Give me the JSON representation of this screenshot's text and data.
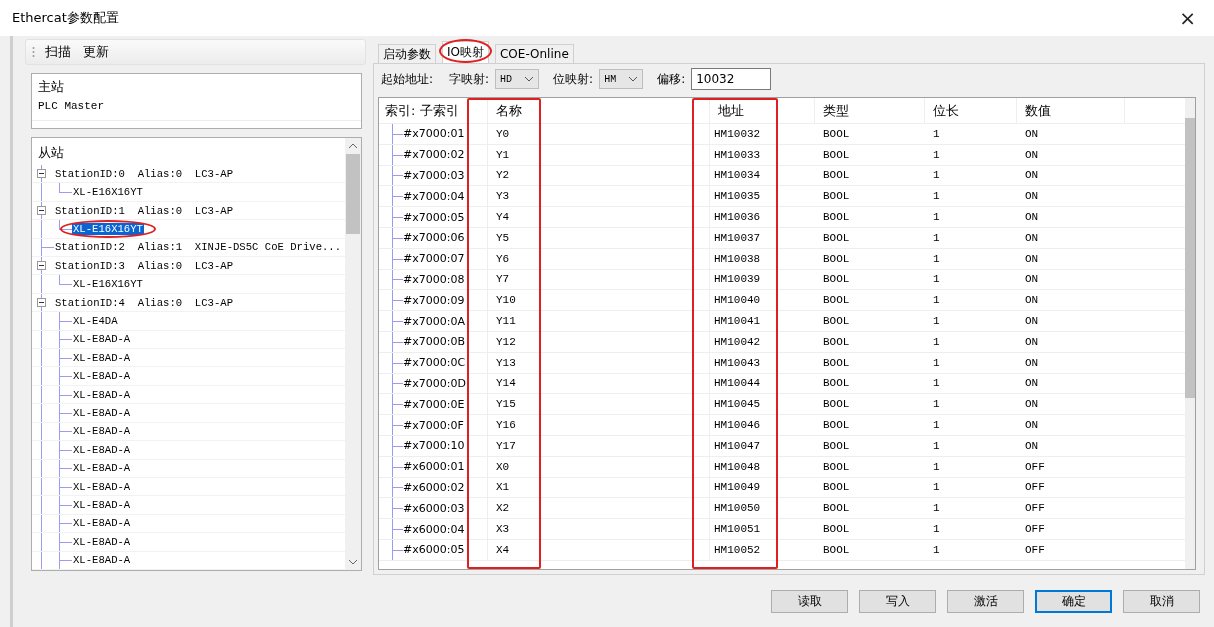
{
  "window": {
    "title": "Ethercat参数配置",
    "close": "×"
  },
  "left_toolbar": {
    "buttons": [
      "扫描",
      "更新"
    ]
  },
  "master": {
    "title": "主站",
    "items": [
      "PLC Master"
    ]
  },
  "slaves": {
    "title": "从站",
    "tree": [
      {
        "label": "StationID:0  Alias:0  LC3-AP",
        "expanded": true,
        "selected": false,
        "children": [
          {
            "label": "XL-E16X16YT",
            "selected": false,
            "circled": false
          }
        ]
      },
      {
        "label": "StationID:1  Alias:0  LC3-AP",
        "expanded": true,
        "selected": false,
        "children": [
          {
            "label": "XL-E16X16YT",
            "selected": true,
            "circled": true
          }
        ]
      },
      {
        "label": "StationID:2  Alias:1  XINJE-DS5C CoE Drive...",
        "selected": false
      },
      {
        "label": "StationID:3  Alias:0  LC3-AP",
        "expanded": true,
        "selected": false,
        "children": [
          {
            "label": "XL-E16X16YT",
            "selected": false,
            "circled": false
          }
        ]
      },
      {
        "label": "StationID:4  Alias:0  LC3-AP",
        "expanded": true,
        "selected": false,
        "children": [
          {
            "label": "XL-E4DA",
            "selected": false,
            "circled": false
          },
          {
            "label": "XL-E8AD-A",
            "selected": false,
            "circled": false
          },
          {
            "label": "XL-E8AD-A",
            "selected": false,
            "circled": false
          },
          {
            "label": "XL-E8AD-A",
            "selected": false,
            "circled": false
          },
          {
            "label": "XL-E8AD-A",
            "selected": false,
            "circled": false
          },
          {
            "label": "XL-E8AD-A",
            "selected": false,
            "circled": false
          },
          {
            "label": "XL-E8AD-A",
            "selected": false,
            "circled": false
          },
          {
            "label": "XL-E8AD-A",
            "selected": false,
            "circled": false
          },
          {
            "label": "XL-E8AD-A",
            "selected": false,
            "circled": false
          },
          {
            "label": "XL-E8AD-A",
            "selected": false,
            "circled": false
          },
          {
            "label": "XL-E8AD-A",
            "selected": false,
            "circled": false
          },
          {
            "label": "XL-E8AD-A",
            "selected": false,
            "circled": false
          },
          {
            "label": "XL-E8AD-A",
            "selected": false,
            "circled": false
          },
          {
            "label": "XL-E8AD-A",
            "selected": false,
            "circled": false
          }
        ]
      }
    ]
  },
  "tabs": [
    {
      "label": "启动参数",
      "selected": false,
      "circled": false
    },
    {
      "label": "IO映射",
      "selected": true,
      "circled": true
    },
    {
      "label": "COE-Online",
      "selected": false,
      "circled": false
    }
  ],
  "mapping": {
    "start_label": "起始地址:",
    "word_label": "字映射:",
    "word_value": "HD",
    "bit_label": "位映射:",
    "bit_value": "HM",
    "offset_label": "偏移:",
    "offset_value": "10032"
  },
  "table": {
    "columns": [
      {
        "label": "索引: 子索引",
        "highlighted": false
      },
      {
        "label": "名称",
        "highlighted": true
      },
      {
        "label": "地址",
        "highlighted": true
      },
      {
        "label": "类型",
        "highlighted": false
      },
      {
        "label": "位长",
        "highlighted": false
      },
      {
        "label": "数值",
        "highlighted": false
      }
    ],
    "rows": [
      [
        "#x7000:01",
        "Y0",
        "HM10032",
        "BOOL",
        "1",
        "ON"
      ],
      [
        "#x7000:02",
        "Y1",
        "HM10033",
        "BOOL",
        "1",
        "ON"
      ],
      [
        "#x7000:03",
        "Y2",
        "HM10034",
        "BOOL",
        "1",
        "ON"
      ],
      [
        "#x7000:04",
        "Y3",
        "HM10035",
        "BOOL",
        "1",
        "ON"
      ],
      [
        "#x7000:05",
        "Y4",
        "HM10036",
        "BOOL",
        "1",
        "ON"
      ],
      [
        "#x7000:06",
        "Y5",
        "HM10037",
        "BOOL",
        "1",
        "ON"
      ],
      [
        "#x7000:07",
        "Y6",
        "HM10038",
        "BOOL",
        "1",
        "ON"
      ],
      [
        "#x7000:08",
        "Y7",
        "HM10039",
        "BOOL",
        "1",
        "ON"
      ],
      [
        "#x7000:09",
        "Y10",
        "HM10040",
        "BOOL",
        "1",
        "ON"
      ],
      [
        "#x7000:0A",
        "Y11",
        "HM10041",
        "BOOL",
        "1",
        "ON"
      ],
      [
        "#x7000:0B",
        "Y12",
        "HM10042",
        "BOOL",
        "1",
        "ON"
      ],
      [
        "#x7000:0C",
        "Y13",
        "HM10043",
        "BOOL",
        "1",
        "ON"
      ],
      [
        "#x7000:0D",
        "Y14",
        "HM10044",
        "BOOL",
        "1",
        "ON"
      ],
      [
        "#x7000:0E",
        "Y15",
        "HM10045",
        "BOOL",
        "1",
        "ON"
      ],
      [
        "#x7000:0F",
        "Y16",
        "HM10046",
        "BOOL",
        "1",
        "ON"
      ],
      [
        "#x7000:10",
        "Y17",
        "HM10047",
        "BOOL",
        "1",
        "ON"
      ],
      [
        "#x6000:01",
        "X0",
        "HM10048",
        "BOOL",
        "1",
        "OFF"
      ],
      [
        "#x6000:02",
        "X1",
        "HM10049",
        "BOOL",
        "1",
        "OFF"
      ],
      [
        "#x6000:03",
        "X2",
        "HM10050",
        "BOOL",
        "1",
        "OFF"
      ],
      [
        "#x6000:04",
        "X3",
        "HM10051",
        "BOOL",
        "1",
        "OFF"
      ],
      [
        "#x6000:05",
        "X4",
        "HM10052",
        "BOOL",
        "1",
        "OFF"
      ]
    ]
  },
  "buttons": [
    {
      "label": "读取",
      "default": false
    },
    {
      "label": "写入",
      "default": false
    },
    {
      "label": "激活",
      "default": false
    },
    {
      "label": "确定",
      "default": true
    },
    {
      "label": "取消",
      "default": false
    }
  ]
}
